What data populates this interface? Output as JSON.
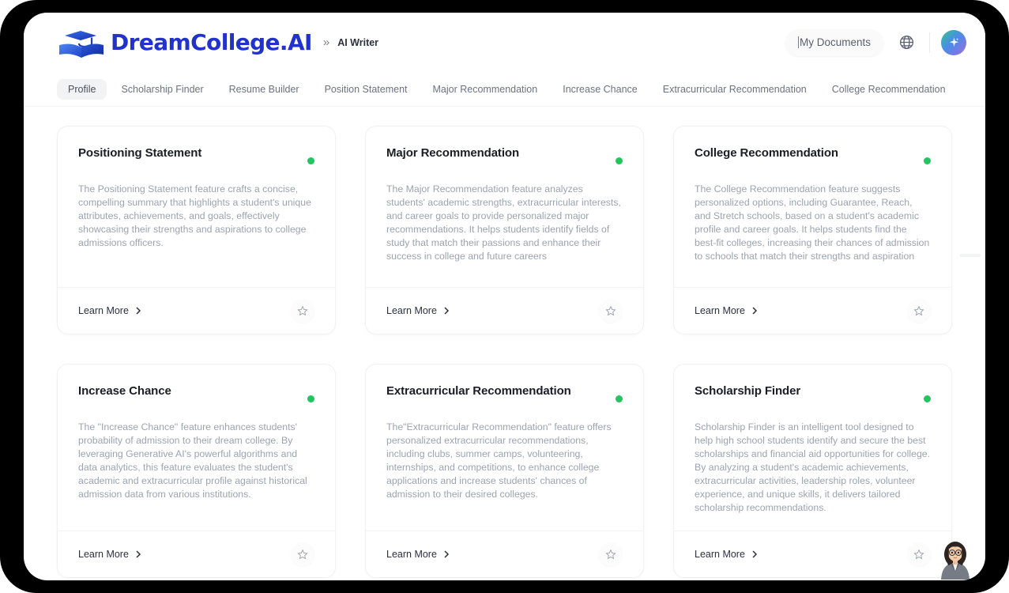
{
  "header": {
    "brand_name": "DreamCollege.AI",
    "logo_icon": "graduation-cap-book-icon",
    "breadcrumb_separator": "»",
    "breadcrumb_current": "AI Writer",
    "my_documents_label": "My Documents",
    "globe_icon": "globe-icon",
    "avatar_icon": "sparkle-icon",
    "accent_color": "#2233cc",
    "avatar_gradient": [
      "#34c88a",
      "#4a8ce8",
      "#9b6ce0"
    ]
  },
  "tabs": [
    {
      "label": "Profile",
      "active": true
    },
    {
      "label": "Scholarship Finder",
      "active": false
    },
    {
      "label": "Resume Builder",
      "active": false
    },
    {
      "label": "Position Statement",
      "active": false
    },
    {
      "label": "Major Recommendation",
      "active": false
    },
    {
      "label": "Increase Chance",
      "active": false
    },
    {
      "label": "Extracurricular Recommendation",
      "active": false
    },
    {
      "label": "College Recommendation",
      "active": false
    }
  ],
  "common": {
    "learn_more_label": "Learn More",
    "chevron_icon": "chevron-right-icon",
    "favorite_icon": "star-outline-icon",
    "status_color": "#22c55e"
  },
  "cards": [
    {
      "title": "Positioning Statement",
      "description": "The Positioning Statement feature crafts a concise, compelling summary that highlights a student's unique attributes, achievements, and goals, effectively showcasing their strengths and aspirations to college admissions officers.",
      "status": "active"
    },
    {
      "title": "Major Recommendation",
      "description": "The Major Recommendation feature analyzes students' academic strengths, extracurricular interests, and career goals to provide personalized major recommendations. It helps students identify fields of study that match their passions and enhance their success in college and future careers",
      "status": "active"
    },
    {
      "title": "College Recommendation",
      "description": "The College Recommendation feature suggests personalized options, including Guarantee, Reach, and Stretch schools, based on a student's academic profile and career goals. It helps students find the best-fit colleges, increasing their chances of admission to schools that match their strengths and aspiration",
      "status": "active"
    },
    {
      "title": "Increase Chance",
      "description": "The \"Increase Chance\" feature enhances students' probability of admission to their dream college. By leveraging Generative AI's powerful algorithms and data analytics, this feature evaluates the student's academic and extracurricular profile against historical admission data from various institutions.",
      "status": "active"
    },
    {
      "title": "Extracurricular Recommendation",
      "description": "The\"Extracurricular Recommendation\" feature offers personalized extracurricular recommendations, including clubs, summer camps, volunteering, internships, and competitions, to enhance college applications and increase students' chances of admission to their desired colleges.",
      "status": "active"
    },
    {
      "title": "Scholarship Finder",
      "description": "Scholarship Finder is an intelligent tool designed to help high school students identify and secure the best scholarships and financial aid opportunities for college. By analyzing a student's academic achievements, extracurricular activities, leadership roles, volunteer experience, and unique skills, it delivers tailored scholarship recommendations.",
      "status": "active"
    }
  ],
  "assistant": {
    "icon": "assistant-avatar-icon"
  }
}
